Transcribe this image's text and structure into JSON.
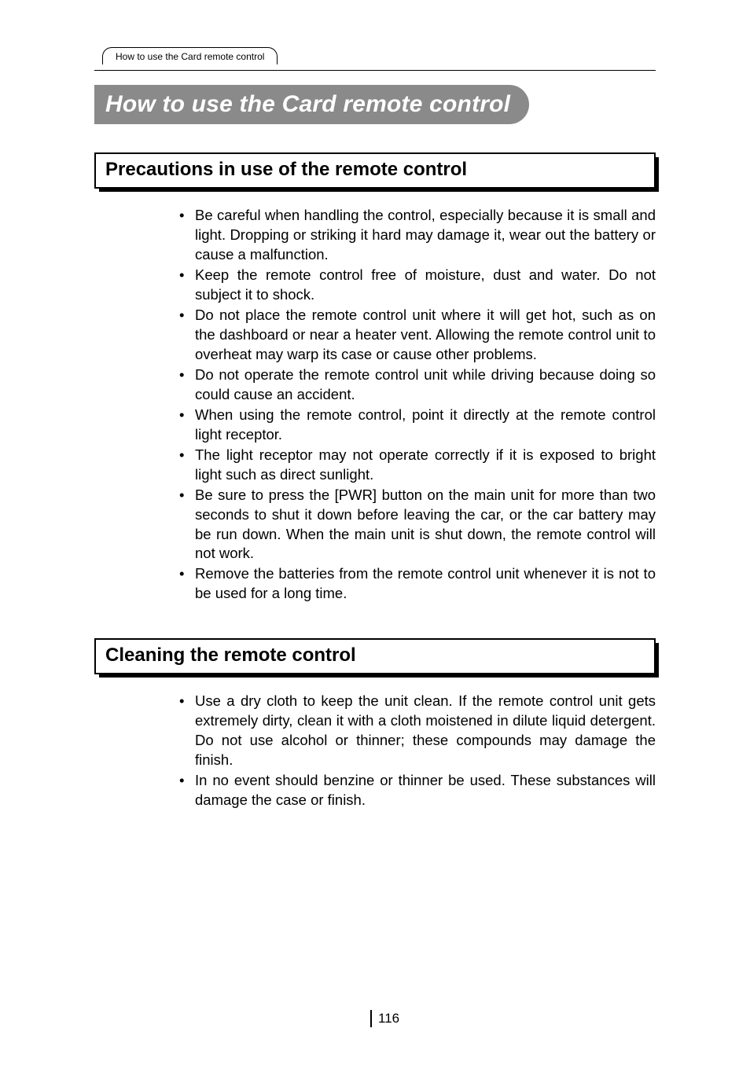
{
  "tab": {
    "label": "How to use the Card remote control"
  },
  "title": "How to use the Card remote control",
  "sections": [
    {
      "heading": "Precautions in use of the remote control",
      "items": [
        "Be careful when handling the control, especially because it is small and light. Dropping or striking it hard may damage it, wear out the battery or cause a malfunction.",
        "Keep the remote control free of moisture, dust and water. Do not subject it to shock.",
        "Do not place the remote control unit where it will get hot, such as on the dashboard or near a heater vent.  Allowing the remote control unit to overheat may warp its case or cause other problems.",
        "Do not operate the remote control unit while driving because doing so could cause an accident.",
        "When using the remote control, point it directly at the remote control light receptor.",
        "The light receptor may not operate correctly if it is exposed to bright light such as direct sunlight.",
        "Be sure to press the [PWR] button on the main unit for more than two seconds to shut it down before leaving the car, or the car battery may be run down. When the main unit is shut down, the remote control will not work.",
        "Remove the batteries from the remote control unit whenever it is not to be used for a long time."
      ]
    },
    {
      "heading": "Cleaning the remote control",
      "items": [
        "Use a dry cloth to keep the unit clean.  If the remote control unit gets extremely dirty, clean it with a cloth moistened in dilute liquid detergent.  Do not use alcohol or thinner; these compounds may damage the finish.",
        "In no event should benzine or thinner be used. These substances will damage the case or finish."
      ]
    }
  ],
  "pageNumber": "116"
}
